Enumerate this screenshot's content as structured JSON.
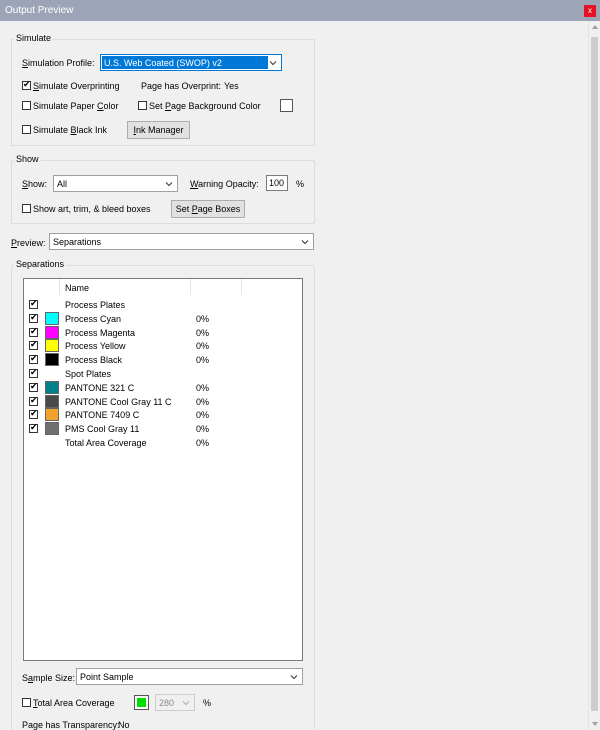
{
  "window": {
    "title": "Output Preview",
    "close_glyph": "x"
  },
  "simulate": {
    "group_label": "Simulate",
    "profile_label_u": "S",
    "profile_label_rest": "imulation Profile:",
    "profile_value": "U.S. Web Coated (SWOP) v2",
    "overprint_label_u": "S",
    "overprint_label_rest": "imulate Overprinting",
    "overprint_checked": true,
    "page_has_overprint_label": "Page has Overprint:",
    "page_has_overprint_value": "Yes",
    "paper_label_pre": "Simulate Paper ",
    "paper_label_u": "C",
    "paper_label_rest": "olor",
    "paper_checked": false,
    "bg_label_pre": "Set ",
    "bg_label_u": "P",
    "bg_label_rest": "age Background Color",
    "bg_checked": false,
    "black_ink_label_pre": "Simulate ",
    "black_ink_label_u": "B",
    "black_ink_label_rest": "lack Ink",
    "black_ink_checked": false,
    "ink_manager_u": "I",
    "ink_manager_rest": "nk Manager"
  },
  "show": {
    "group_label": "Show",
    "show_label_u": "S",
    "show_label_rest": "how:",
    "show_value": "All",
    "warning_label_u": "W",
    "warning_label_rest": "arning Opacity:",
    "warning_value": "100",
    "warning_unit": "%",
    "art_trim_label": "Show art, trim, & bleed boxes",
    "art_trim_checked": false,
    "set_page_boxes_pre": "Set ",
    "set_page_boxes_u": "P",
    "set_page_boxes_rest": "age Boxes"
  },
  "preview": {
    "label_u": "P",
    "label_rest": "review:",
    "value": "Separations"
  },
  "separations": {
    "group_label": "Separations",
    "column_name": "Name",
    "rows": [
      {
        "checked": true,
        "swatch": null,
        "name": "Process Plates",
        "pct": ""
      },
      {
        "checked": true,
        "swatch": "#00ffff",
        "name": "Process Cyan",
        "pct": "0%"
      },
      {
        "checked": true,
        "swatch": "#ff00ff",
        "name": "Process Magenta",
        "pct": "0%"
      },
      {
        "checked": true,
        "swatch": "#ffff00",
        "name": "Process Yellow",
        "pct": "0%"
      },
      {
        "checked": true,
        "swatch": "#000000",
        "name": "Process Black",
        "pct": "0%"
      },
      {
        "checked": true,
        "swatch": null,
        "name": "Spot Plates",
        "pct": ""
      },
      {
        "checked": true,
        "swatch": "#00818a",
        "name": "PANTONE 321 C",
        "pct": "0%"
      },
      {
        "checked": true,
        "swatch": "#4a4a4a",
        "name": "PANTONE Cool Gray 11 C",
        "pct": "0%"
      },
      {
        "checked": true,
        "swatch": "#f0a22a",
        "name": "PANTONE 7409 C",
        "pct": "0%"
      },
      {
        "checked": true,
        "swatch": "#6f6f6f",
        "name": "PMS Cool Gray 11",
        "pct": "0%"
      },
      {
        "checked": null,
        "swatch": null,
        "name": "Total Area Coverage",
        "pct": "0%"
      }
    ]
  },
  "sample": {
    "label_pre": "S",
    "label_u": "a",
    "label_rest": "mple Size:",
    "value": "Point Sample"
  },
  "coverage": {
    "label_u": "T",
    "label_rest": "otal Area Coverage",
    "checked": false,
    "swatch": "#00e000",
    "value": "280",
    "unit": "%"
  },
  "transparency": {
    "label": "Page has Transparency:",
    "value": "No"
  }
}
